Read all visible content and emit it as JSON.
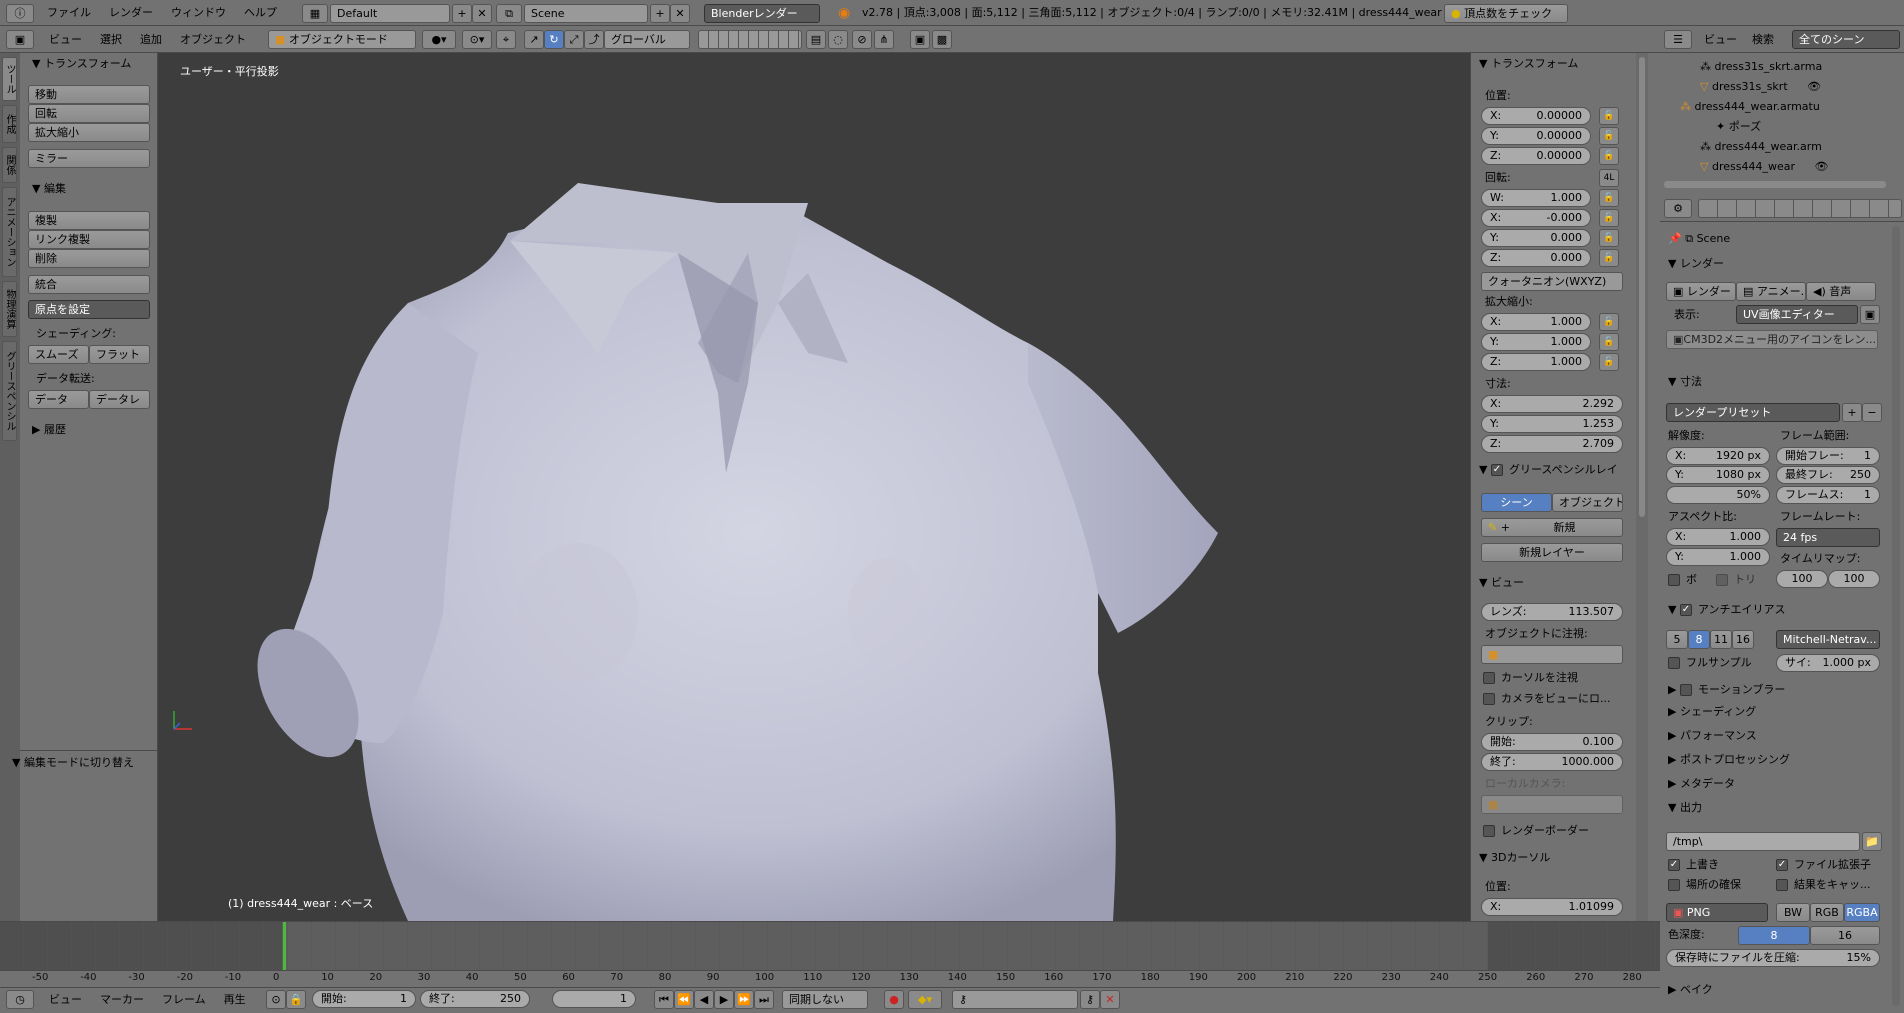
{
  "topbar": {
    "menus": [
      "ファイル",
      "レンダー",
      "ウィンドウ",
      "ヘルプ"
    ],
    "screen_layout": "Default",
    "scene": "Scene",
    "engine": "Blenderレンダー",
    "stats": "v2.78 | 頂点:3,008 | 面:5,112 | 三角面:5,112 | オブジェクト:0/4 | ランプ:0/0 | メモリ:32.41M | dress444_wear",
    "check_button": "頂点数をチェック"
  },
  "vp_header": {
    "menus": [
      "ビュー",
      "選択",
      "追加",
      "オブジェクト"
    ],
    "mode": "オブジェクトモード",
    "orientation": "グローバル"
  },
  "tool_tabs": [
    "ツール",
    "作成",
    "関係",
    "アニメーション",
    "物理演算",
    "グリースペンシル"
  ],
  "tool_shelf": {
    "transform_title": "トランスフォーム",
    "transform_buttons": [
      "移動",
      "回転",
      "拡大縮小"
    ],
    "mirror": "ミラー",
    "edit_title": "編集",
    "edit_buttons": [
      "複製",
      "リンク複製",
      "削除"
    ],
    "join": "統合",
    "origin": "原点を設定",
    "shading_label": "シェーディング:",
    "smooth": "スムーズ",
    "flat": "フラット",
    "data_transfer_label": "データ転送:",
    "data": "データ",
    "data_layer": "データレ",
    "history_title": "履歴",
    "operator_title": "編集モードに切り替え"
  },
  "viewport": {
    "view_label": "ユーザー・平行投影",
    "object_label": "(1) dress444_wear : ベース"
  },
  "n_panel": {
    "transform_title": "トランスフォーム",
    "location_label": "位置:",
    "location": [
      {
        "axis": "X:",
        "value": "0.00000"
      },
      {
        "axis": "Y:",
        "value": "0.00000"
      },
      {
        "axis": "Z:",
        "value": "0.00000"
      }
    ],
    "rotation_label": "回転:",
    "rotation_badge": "4L",
    "rotation": [
      {
        "axis": "W:",
        "value": "1.000"
      },
      {
        "axis": "X:",
        "value": "-0.000"
      },
      {
        "axis": "Y:",
        "value": "0.000"
      },
      {
        "axis": "Z:",
        "value": "0.000"
      }
    ],
    "rotation_mode": "クォータニオン(WXYZ)",
    "scale_label": "拡大縮小:",
    "scale": [
      {
        "axis": "X:",
        "value": "1.000"
      },
      {
        "axis": "Y:",
        "value": "1.000"
      },
      {
        "axis": "Z:",
        "value": "1.000"
      }
    ],
    "dimensions_label": "寸法:",
    "dimensions": [
      {
        "axis": "X:",
        "value": "2.292"
      },
      {
        "axis": "Y:",
        "value": "1.253"
      },
      {
        "axis": "Z:",
        "value": "2.709"
      }
    ],
    "grease_title": "グリースペンシルレイ",
    "scene_tab": "シーン",
    "object_tab": "オブジェクト",
    "new": "新規",
    "new_layer": "新規レイヤー",
    "view_title": "ビュー",
    "lens_label": "レンズ:",
    "lens_value": "113.507",
    "lock_object_label": "オブジェクトに注視:",
    "lock_cursor": "カーソルを注視",
    "lock_camera": "カメラをビューにロ...",
    "clip_label": "クリップ:",
    "clip_start_label": "開始:",
    "clip_start": "0.100",
    "clip_end_label": "終了:",
    "clip_end": "1000.000",
    "local_camera_label": "ローカルカメラ:",
    "render_border": "レンダーボーダー",
    "cursor_title": "3Dカーソル",
    "cursor_location_label": "位置:",
    "cursor_x_axis": "X:",
    "cursor_x": "1.01099"
  },
  "outliner": {
    "menus": [
      "ビュー",
      "検索"
    ],
    "filter": "全てのシーン",
    "items": [
      "dress31s_skrt.arma",
      "dress31s_skrt",
      "dress444_wear.armatu",
      "ポーズ",
      "dress444_wear.arm",
      "dress444_wear"
    ]
  },
  "properties": {
    "scene_name": "Scene",
    "render_title": "レンダー",
    "render_btn": "レンダー",
    "anim_btn": "アニメー...",
    "sound_btn": "音声",
    "display_label": "表示:",
    "display_value": "UV画像エディター",
    "cm3d2_btn": "CM3D2メニュー用のアイコンをレン...",
    "dimensions_title": "寸法",
    "preset": "レンダープリセット",
    "resolution_label": "解像度:",
    "res_x_axis": "X:",
    "res_x": "1920 px",
    "res_y_axis": "Y:",
    "res_y": "1080 px",
    "res_pct": "50%",
    "frame_range_label": "フレーム範囲:",
    "frame_start_label": "開始フレー:",
    "frame_start": "1",
    "frame_end_label": "最終フレ:",
    "frame_end": "250",
    "frame_step_label": "フレームス:",
    "frame_step": "1",
    "aspect_label": "アスペクト比:",
    "aspect_x_axis": "X:",
    "aspect_x": "1.000",
    "aspect_y_axis": "Y:",
    "aspect_y": "1.000",
    "framerate_label": "フレームレート:",
    "framerate": "24 fps",
    "border_chk": "ボ",
    "crop_chk": "トリ",
    "time_remap_label": "タイムリマップ:",
    "remap_old": "100",
    "remap_new": "100",
    "aa_title": "アンチエイリアス",
    "aa_samples": [
      "5",
      "8",
      "11",
      "16"
    ],
    "aa_filter": "Mitchell-Netrav...",
    "full_sample": "フルサンプル",
    "filter_size_label": "サイ:",
    "filter_size": "1.000 px",
    "sections": [
      "モーションブラー",
      "シェーディング",
      "パフォーマンス",
      "ポストプロセッシング",
      "メタデータ"
    ],
    "output_title": "出力",
    "output_path": "/tmp\\",
    "overwrite": "上書き",
    "extensions": "ファイル拡張子",
    "placeholders": "場所の確保",
    "cache": "結果をキャッ...",
    "format": "PNG",
    "color_modes": [
      "BW",
      "RGB",
      "RGBA"
    ],
    "color_depth_label": "色深度:",
    "depth_8": "8",
    "depth_16": "16",
    "compression_label": "保存時にファイルを圧縮:",
    "compression": "15%",
    "bake_title": "ベイク"
  },
  "timeline": {
    "ticks": [
      "-50",
      "-40",
      "-30",
      "-20",
      "-10",
      "0",
      "10",
      "20",
      "30",
      "40",
      "50",
      "60",
      "70",
      "80",
      "90",
      "100",
      "110",
      "120",
      "130",
      "140",
      "150",
      "160",
      "170",
      "180",
      "190",
      "200",
      "210",
      "220",
      "230",
      "240",
      "250",
      "260",
      "270",
      "280"
    ],
    "menus": [
      "ビュー",
      "マーカー",
      "フレーム",
      "再生"
    ],
    "start_label": "開始:",
    "start": "1",
    "end_label": "終了:",
    "end": "250",
    "current": "1",
    "sync": "同期しない"
  },
  "colors": {
    "accent": "#5680c2",
    "viewport_bg": "#3d3d3d",
    "cloth": "#c8c9d8"
  }
}
